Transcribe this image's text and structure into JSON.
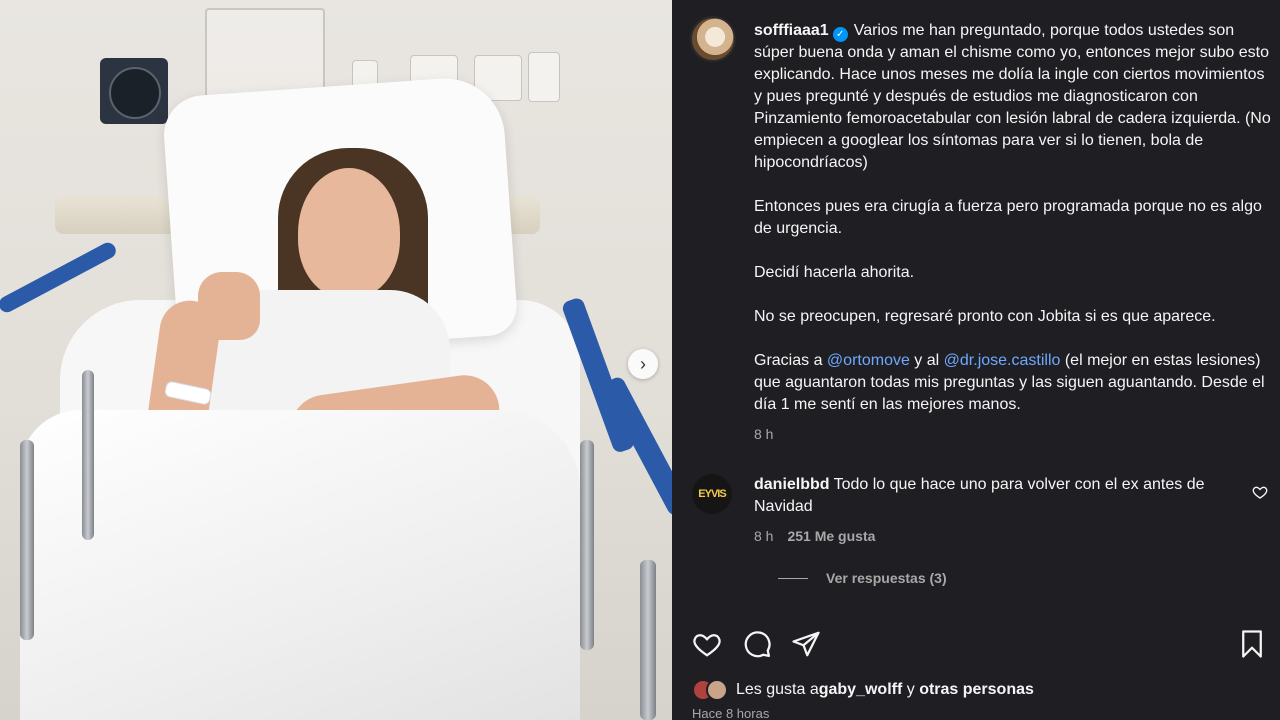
{
  "post": {
    "username": "sofffiaaa1",
    "verified_glyph": "✓",
    "caption_p1": "Varios me han preguntado, porque todos ustedes son súper buena onda y aman el chisme como yo, entonces mejor subo esto explicando. Hace unos meses me dolía la ingle con ciertos movimientos y pues pregunté y después de estudios me diagnosticaron con Pinzamiento femoroacetabular con lesión labral de cadera izquierda. (No empiecen a googlear los síntomas para ver si lo tienen, bola de hipocondríacos)",
    "caption_p2": "Entonces pues era cirugía a fuerza pero programada porque no es algo de urgencia.",
    "caption_p3": "Decidí hacerla ahorita.",
    "caption_p4": "No se preocupen, regresaré pronto con Jobita si es que aparece.",
    "caption_p5_a": "Gracias a ",
    "mention_1": "@ortomove",
    "caption_p5_b": " y al ",
    "mention_2": "@dr.jose.castillo",
    "caption_p5_c": " (el mejor en estas lesiones) que aguantaron todas mis preguntas y las siguen aguantando. Desde el día 1 me sentí en las mejores manos.",
    "time": "8 h"
  },
  "comment": {
    "avatar_text": "EYVIS",
    "username": "danielbbd",
    "text": "Todo lo que hace uno para volver con el ex antes de Navidad",
    "time": "8 h",
    "likes": "251 Me gusta",
    "replies": "Ver respuestas (3)"
  },
  "footer": {
    "likes_prefix": "Les gusta a ",
    "likes_user": "gaby_wolff",
    "likes_mid": " y ",
    "likes_others": "otras personas",
    "time": "Hace 8 horas"
  },
  "icons": {
    "like": "heart-icon",
    "comment": "comment-icon",
    "share": "share-icon",
    "save": "bookmark-icon",
    "next": "chevron-right-icon"
  },
  "colors": {
    "panel_bg": "#1f1f23",
    "mention": "#6ea8fe",
    "verified": "#0095f6"
  }
}
